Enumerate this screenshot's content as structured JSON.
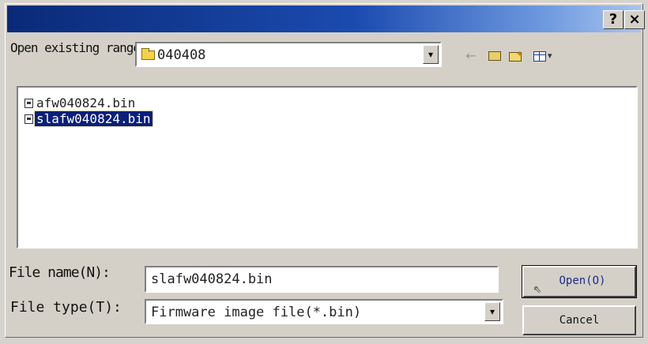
{
  "titlebar": {
    "title": "",
    "help_label": "?",
    "close_label": "×"
  },
  "lookin": {
    "label": "Open existing range (I):",
    "value": "040408"
  },
  "files": [
    {
      "name": "afw040824.bin",
      "selected": false
    },
    {
      "name": "slafw040824.bin",
      "selected": true
    }
  ],
  "filename": {
    "label": "File name(N):",
    "value": "slafw040824.bin"
  },
  "filetype": {
    "label": "File type(T):",
    "value": "Firmware image file(*.bin)"
  },
  "buttons": {
    "open": "Open(O)",
    "cancel": "Cancel"
  },
  "colors": {
    "title_start": "#0a2a78",
    "title_end": "#a9c4ee",
    "selection": "#0a1f7a"
  }
}
